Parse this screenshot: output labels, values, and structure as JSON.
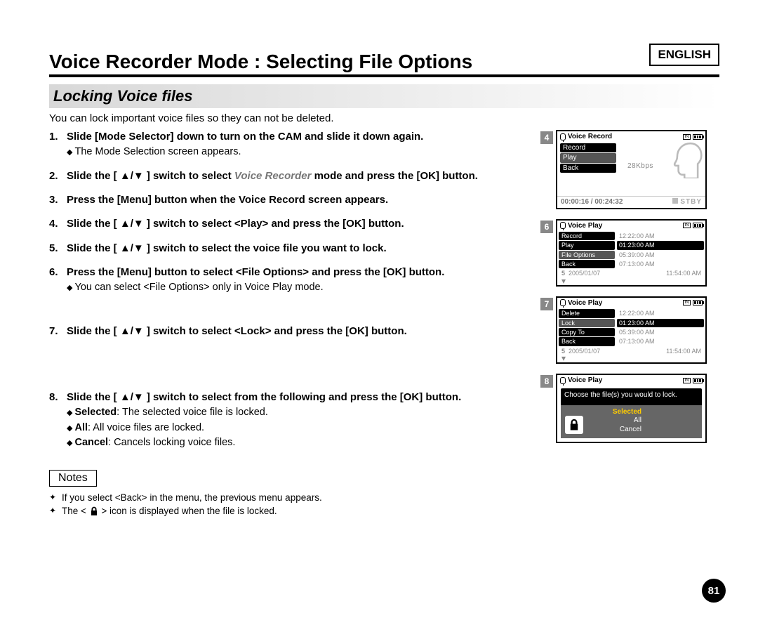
{
  "lang": "ENGLISH",
  "title": "Voice Recorder Mode : Selecting File Options",
  "subtitle": "Locking Voice files",
  "intro": "You can lock important voice files so they can not be deleted.",
  "steps": {
    "s1": {
      "head": "Slide [Mode Selector] down to turn on the CAM and slide it down again.",
      "sub": "The Mode Selection screen appears."
    },
    "s2": {
      "head_a": "Slide the [ ",
      "head_b": " ] switch to select ",
      "head_em": "Voice Recorder",
      "head_c": " mode and press the [OK] button."
    },
    "s3": {
      "head": "Press the [Menu] button when the Voice Record screen appears."
    },
    "s4": {
      "head_a": "Slide the [ ",
      "head_b": " ] switch to select <Play> and press the [OK] button."
    },
    "s5": {
      "head_a": "Slide the [ ",
      "head_b": " ] switch to select the voice file you want to lock."
    },
    "s6": {
      "head": "Press the [Menu] button to select <File Options> and press the [OK] button.",
      "sub": "You can select <File Options> only in Voice Play mode."
    },
    "s7": {
      "head_a": "Slide the [ ",
      "head_b": " ] switch to select <Lock> and press the [OK] button."
    },
    "s8": {
      "head_a": "Slide the [ ",
      "head_b": " ] switch to select from the following and press the [OK] button.",
      "opt1_b": "Selected",
      "opt1": ": The selected voice file is locked.",
      "opt2_b": "All",
      "opt2": ": All voice files are locked.",
      "opt3_b": "Cancel",
      "opt3": ": Cancels locking voice files."
    }
  },
  "notes_label": "Notes",
  "notes": {
    "n1": "If you select <Back> in the menu, the previous menu appears.",
    "n2_a": "The < ",
    "n2_b": " > icon is displayed when the file is locked."
  },
  "page_num": "81",
  "shot4": {
    "badge": "4",
    "title": "Voice Record",
    "m1": "Record",
    "m2": "Play",
    "m3": "Back",
    "rate": "28Kbps",
    "time": "00:00:16 / 00:24:32",
    "status": "STBY"
  },
  "shot6": {
    "badge": "6",
    "title": "Voice Play",
    "m1": "Record",
    "m2": "Play",
    "m3": "File Options",
    "m4": "Back",
    "t1": "12:22:00 AM",
    "t2": "01:23:00 AM",
    "t3": "05:39:00 AM",
    "t4": "07:13:00 AM",
    "last_n": "5",
    "last_d": "2005/01/07",
    "last_t": "11:54:00 AM"
  },
  "shot7": {
    "badge": "7",
    "title": "Voice Play",
    "m1": "Delete",
    "m2": "Lock",
    "m3": "Copy To",
    "m4": "Back",
    "t1": "12:22:00 AM",
    "t2": "01:23:00 AM",
    "t3": "05:39:00 AM",
    "t4": "07:13:00 AM",
    "last_n": "5",
    "last_d": "2005/01/07",
    "last_t": "11:54:00 AM"
  },
  "shot8": {
    "badge": "8",
    "title": "Voice Play",
    "prompt": "Choose the file(s) you would to lock.",
    "o1": "Selected",
    "o2": "All",
    "o3": "Cancel"
  }
}
